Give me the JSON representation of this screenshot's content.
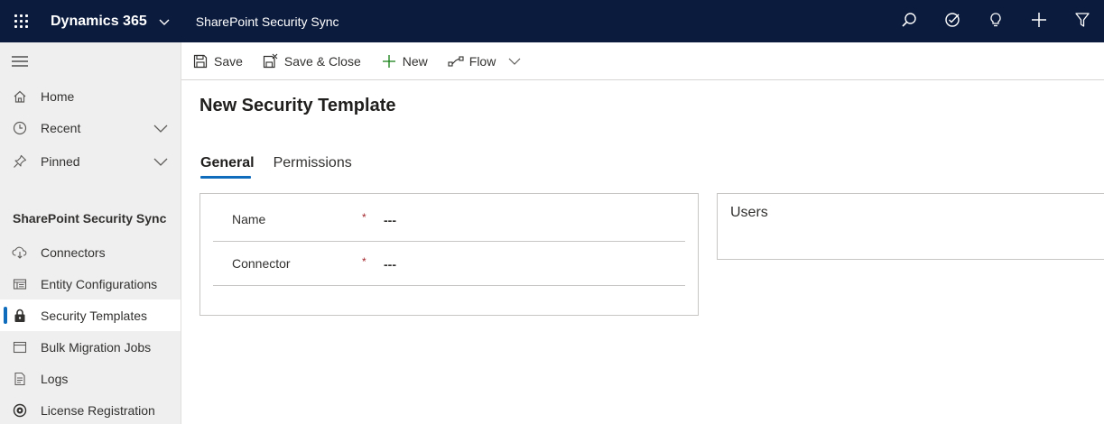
{
  "topbar": {
    "brand": "Dynamics 365",
    "app_title": "SharePoint Security Sync",
    "actions": [
      {
        "icon": "search-icon"
      },
      {
        "icon": "task-check-icon"
      },
      {
        "icon": "lightbulb-icon"
      },
      {
        "icon": "plus-icon"
      },
      {
        "icon": "filter-icon"
      }
    ]
  },
  "sidebar": {
    "nav": [
      {
        "label": "Home",
        "icon": "home-icon"
      },
      {
        "label": "Recent",
        "icon": "clock-icon"
      },
      {
        "label": "Pinned",
        "icon": "pin-icon"
      }
    ],
    "section_title": "SharePoint Security Sync",
    "items": [
      {
        "label": "Connectors",
        "icon": "cloud-sync-icon"
      },
      {
        "label": "Entity Configurations",
        "icon": "entity-icon"
      },
      {
        "label": "Security Templates",
        "icon": "lock-icon",
        "selected": true
      },
      {
        "label": "Bulk Migration Jobs",
        "icon": "window-icon"
      },
      {
        "label": "Logs",
        "icon": "document-icon"
      },
      {
        "label": "License Registration",
        "icon": "license-icon"
      }
    ]
  },
  "commandbar": {
    "save": "Save",
    "save_close": "Save & Close",
    "new": "New",
    "flow": "Flow"
  },
  "form": {
    "title": "New Security Template",
    "tabs": [
      {
        "label": "General",
        "active": true
      },
      {
        "label": "Permissions",
        "active": false
      }
    ],
    "fields": [
      {
        "label": "Name",
        "required_mark": "*",
        "value": "---"
      },
      {
        "label": "Connector",
        "required_mark": "*",
        "value": "---"
      }
    ],
    "users_section_title": "Users"
  },
  "colors": {
    "topbar_bg": "#0b1b3d",
    "accent": "#0f6cbd",
    "required": "#a4262c",
    "sidebar_bg": "#efefef",
    "new_icon": "#107c10"
  }
}
